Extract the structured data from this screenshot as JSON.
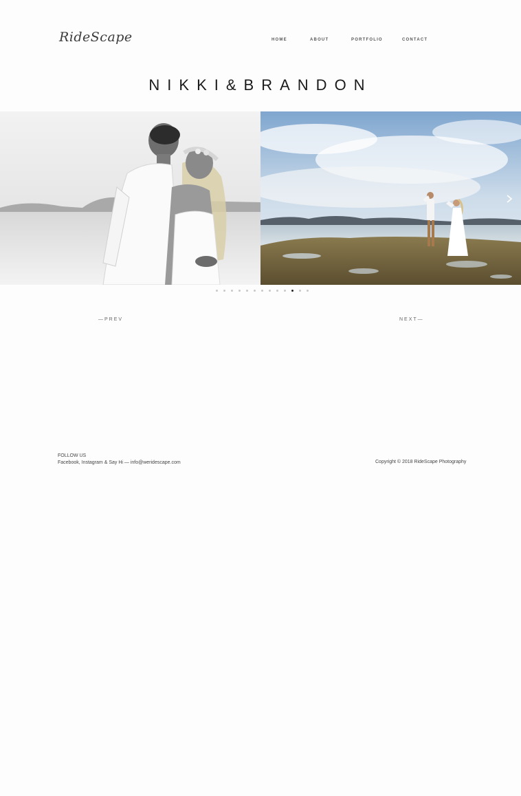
{
  "header": {
    "logo_text": "RideScape",
    "nav": [
      {
        "label": "HOME"
      },
      {
        "label": "ABOUT"
      },
      {
        "label": "PORTFOLIO"
      },
      {
        "label": "CONTACT"
      }
    ]
  },
  "page_title": "NIKKI&BRANDON",
  "gallery": {
    "slide_count": 13,
    "active_index": 10,
    "next_arrow_icon": "chevron-right-icon"
  },
  "pager": {
    "prev_label": "—PREV",
    "next_label": "NEXT—"
  },
  "footer": {
    "follow_label": "FOLLOW US",
    "follow_line": "Facebook, Instagram & Say Hi — info@weridescape.com",
    "copyright": "Copyright © 2018 RideScape Photography"
  }
}
